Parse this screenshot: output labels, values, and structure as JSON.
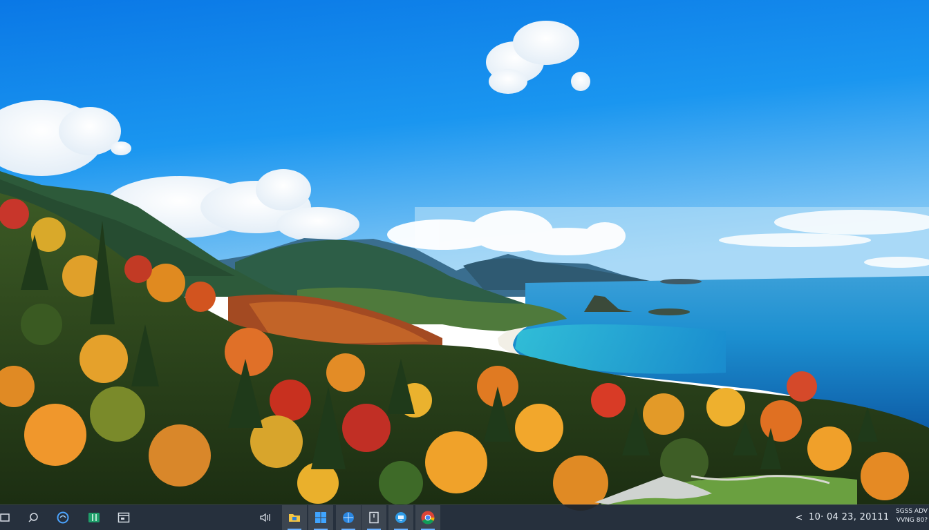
{
  "taskbar": {
    "left_icons": [
      {
        "name": "start-icon"
      },
      {
        "name": "search-icon"
      },
      {
        "name": "edge-icon"
      },
      {
        "name": "spreadsheet-icon"
      },
      {
        "name": "task-view-icon"
      }
    ],
    "center_icons": [
      {
        "name": "volume-icon"
      },
      {
        "name": "file-explorer-icon"
      },
      {
        "name": "windows-logo-icon"
      },
      {
        "name": "browser-icon"
      },
      {
        "name": "document-icon"
      },
      {
        "name": "remote-desktop-icon"
      },
      {
        "name": "chrome-icon"
      }
    ],
    "tray_chevron": "<",
    "clock": "10· 04 23, 20111",
    "notify_line1": "SGSS ADV",
    "notify_line2": "VVNG 80?",
    "colors": {
      "taskbar_bg": "#141e2d",
      "accent": "#6ab0ff"
    }
  }
}
